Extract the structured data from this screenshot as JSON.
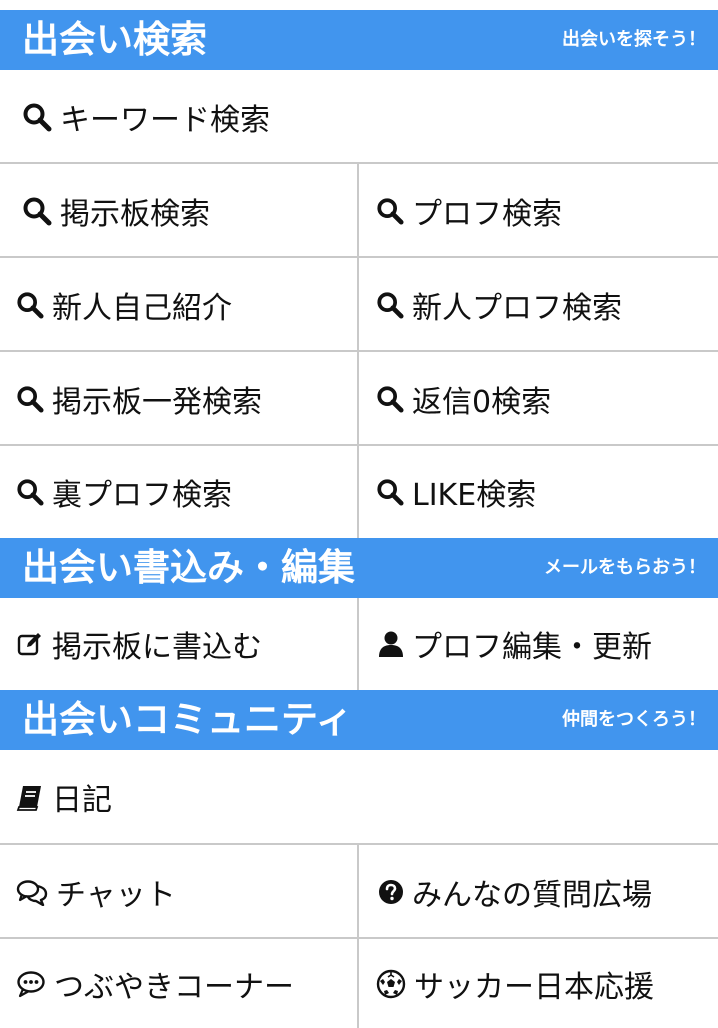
{
  "sections": {
    "search": {
      "title": "出会い検索",
      "subtitle": "出会いを探そう！",
      "items": [
        {
          "label": "キーワード検索",
          "icon": "search-icon"
        },
        {
          "label": "掲示板検索",
          "icon": "search-icon"
        },
        {
          "label": "プロフ検索",
          "icon": "search-icon"
        },
        {
          "label": "新人自己紹介",
          "icon": "search-icon"
        },
        {
          "label": "新人プロフ検索",
          "icon": "search-icon"
        },
        {
          "label": "掲示板一発検索",
          "icon": "search-icon"
        },
        {
          "label": "返信0検索",
          "icon": "search-icon"
        },
        {
          "label": "裏プロフ検索",
          "icon": "search-icon"
        },
        {
          "label": "LIKE検索",
          "icon": "search-icon"
        }
      ]
    },
    "write": {
      "title": "出会い書込み・編集",
      "subtitle": "メールをもらおう！",
      "items": [
        {
          "label": "掲示板に書込む",
          "icon": "edit-icon"
        },
        {
          "label": "プロフ編集・更新",
          "icon": "user-icon"
        }
      ]
    },
    "community": {
      "title": "出会いコミュニティ",
      "subtitle": "仲間をつくろう！",
      "items": [
        {
          "label": "日記",
          "icon": "book-icon"
        },
        {
          "label": "チャット",
          "icon": "chat-bubbles-icon"
        },
        {
          "label": "みんなの質問広場",
          "icon": "question-circle-icon"
        },
        {
          "label": "つぶやきコーナー",
          "icon": "comment-dots-icon"
        },
        {
          "label": "サッカー日本応援",
          "icon": "soccer-ball-icon"
        }
      ]
    }
  },
  "colors": {
    "header_bg": "#4195ee",
    "header_text": "#ffffff",
    "divider": "#c9c9c9"
  }
}
